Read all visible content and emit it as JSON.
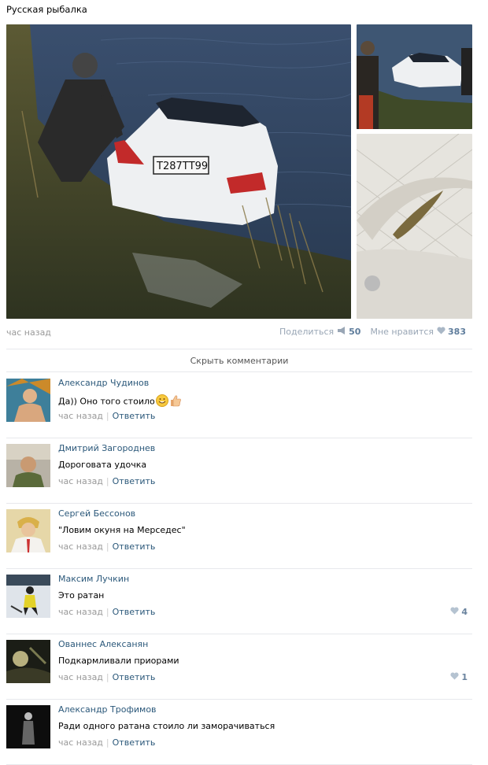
{
  "post": {
    "title": "Русская рыбалка",
    "plate": "Т287ТТ99",
    "time": "час назад",
    "share_label": "Поделиться",
    "share_count": "50",
    "like_label": "Мне нравится",
    "like_count": "383",
    "hide_comments": "Скрыть комментарии"
  },
  "comments": [
    {
      "author": "Александр Чудинов",
      "text": "Да)) Оно того стоило",
      "time": "час назад",
      "reply": "Ответить",
      "likes": ""
    },
    {
      "author": "Дмитрий Загороднев",
      "text": "Дороговата удочка",
      "time": "час назад",
      "reply": "Ответить",
      "likes": ""
    },
    {
      "author": "Сергей Бессонов",
      "text": "\"Ловим окуня на Мерседес\"",
      "time": "час назад",
      "reply": "Ответить",
      "likes": ""
    },
    {
      "author": "Максим Лучкин",
      "text": "Это ратан",
      "time": "час назад",
      "reply": "Ответить",
      "likes": "4"
    },
    {
      "author": "Ованнес Алексанян",
      "text": "Подкармливали приорами",
      "time": "час назад",
      "reply": "Ответить",
      "likes": "1"
    },
    {
      "author": "Александр Трофимов",
      "text": "Ради одного ратана стоило ли заморачиваться",
      "time": "час назад",
      "reply": "Ответить",
      "likes": ""
    }
  ],
  "colors": {
    "link": "#2b587a",
    "muted": "#999999",
    "count": "#5f7d9c",
    "divider": "#e7e8ec"
  }
}
